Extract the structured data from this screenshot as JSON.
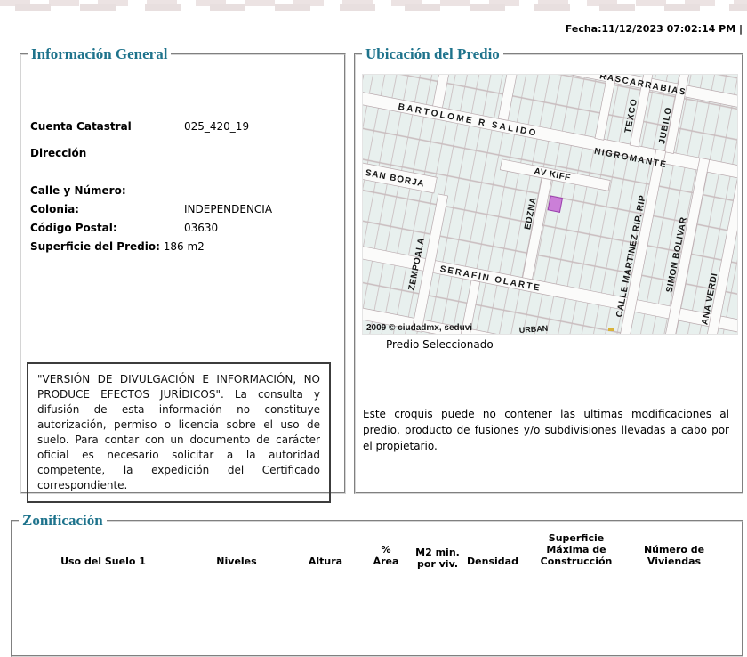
{
  "theme": {
    "legend_color": "#1e738c",
    "selected_parcel_color": "#cb7fd8",
    "banner_color": "#ece3e3"
  },
  "header": {
    "fecha": "Fecha:11/12/2023 07:02:14 PM |"
  },
  "general_info": {
    "legend": "Información General",
    "cuenta_label": "Cuenta Catastral",
    "cuenta_value": "025_420_19",
    "direccion_label": "Dirección",
    "calle_label": "Calle y Número:",
    "calle_value": "",
    "colonia_label": "Colonia:",
    "colonia_value": "INDEPENDENCIA",
    "cp_label": "Código Postal:",
    "cp_value": "03630",
    "superficie_label": "Superficie del Predio:",
    "superficie_value": "186 m2",
    "disclaimer": "\"VERSIÓN DE DIVULGACIÓN E INFORMACIÓN, NO PRODUCE EFECTOS JURÍDICOS\". La consulta y difusión de esta información no constituye autorización, permiso o licencia sobre el uso de suelo. Para contar con un documento de carácter oficial es necesario solicitar a la autoridad competente, la expedición del Certificado correspondiente."
  },
  "ubicacion": {
    "legend": "Ubicación del Predio",
    "map": {
      "labels": {
        "rascarrabias": "RASCARRABIAS",
        "bartolome": "BARTOLOME R SALIDO",
        "nigromante": "NIGROMANTE",
        "av_kiff": "AV KIFF",
        "san_borja": "SAN BORJA",
        "serafin": "SERAFIN OLARTE",
        "texco": "TEXCO",
        "jubilo": "JUBILO",
        "edzna": "EDZNA",
        "martinez": "CALLE MARTINEZ RIP. RIP",
        "simon": "SIMON BOLIVAR",
        "ana": "ANA VERDI",
        "zempoala": "ZEMPOALA"
      },
      "attribution": "2009 © ciudadmx, seduvi",
      "watermark": "URBAN"
    },
    "selected_label": "Predio Seleccionado",
    "croquis_note": "Este croquis puede no contener las ultimas modificaciones al predio, producto de fusiones y/o subdivisiones llevadas a cabo por el propietario."
  },
  "zonificacion": {
    "legend": "Zonificación",
    "columns": [
      {
        "lines": [
          "Uso del Suelo 1"
        ]
      },
      {
        "lines": [
          "Niveles"
        ]
      },
      {
        "lines": [
          "Altura"
        ]
      },
      {
        "lines": [
          "%",
          "Área"
        ]
      },
      {
        "lines": [
          "M2 min.",
          "por viv."
        ]
      },
      {
        "lines": [
          "Densidad"
        ]
      },
      {
        "lines": [
          "Superficie",
          "Máxima de",
          "Construcción"
        ]
      },
      {
        "lines": [
          "Número de",
          "Viviendas"
        ]
      }
    ]
  }
}
